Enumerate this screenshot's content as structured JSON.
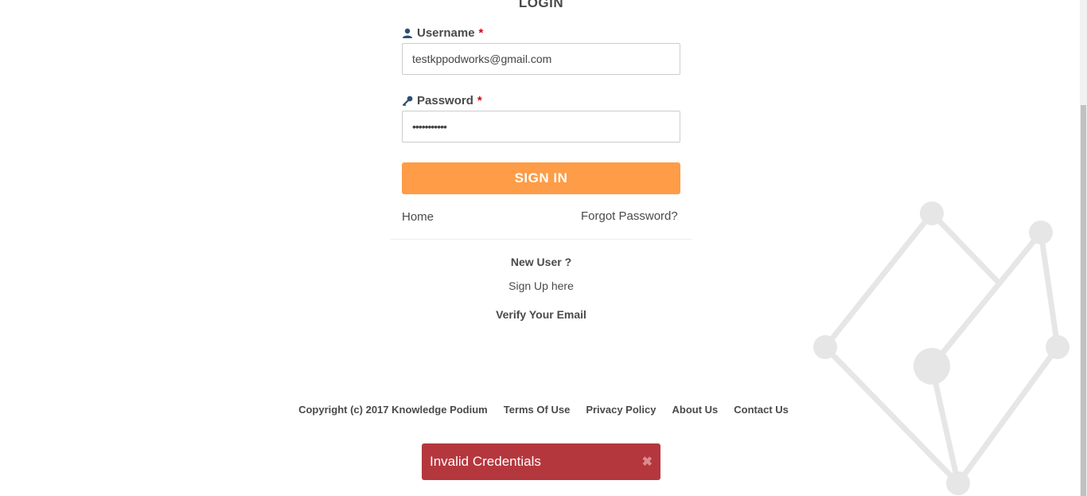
{
  "login": {
    "title": "LOGIN",
    "username_label": "Username",
    "password_label": "Password",
    "required_marker": "*",
    "username_value": "testkppodworks@gmail.com",
    "password_value": "•••••••••••",
    "signin_label": "SIGN IN",
    "home_link": "Home",
    "forgot_link": "Forgot Password?"
  },
  "signup": {
    "new_user": "New User ?",
    "signup_link": "Sign Up here",
    "verify_email": "Verify Your Email"
  },
  "footer": {
    "copyright": "Copyright (c) 2017 Knowledge Podium",
    "terms": "Terms Of Use",
    "privacy": "Privacy Policy",
    "about": "About Us",
    "contact": "Contact Us"
  },
  "toast": {
    "message": "Invalid Credentials",
    "close_icon": "✖"
  },
  "icons": {
    "user": "user-icon",
    "key": "key-icon"
  },
  "colors": {
    "accent": "#fe9c47",
    "error": "#b5373e",
    "required": "#d0021b"
  }
}
